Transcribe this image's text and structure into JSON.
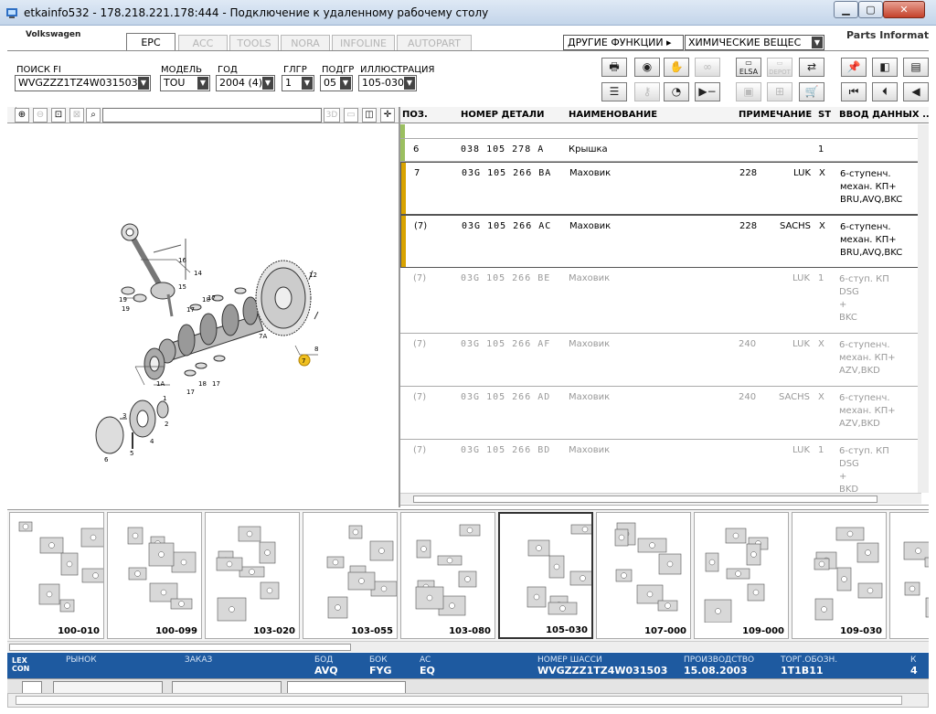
{
  "window": {
    "title": "etkainfo532 - 178.218.221.178:444 - Подключение к удаленному рабочему столу"
  },
  "brand": "Volkswagen",
  "parts_info": "Parts Informati",
  "tabs": [
    "EPC",
    "ACC",
    "TOOLS",
    "NORA",
    "INFOLINE",
    "AUTOPART"
  ],
  "menus": {
    "other_functions": "ДРУГИЕ ФУНКЦИИ ▸",
    "chemicals": "ХИМИЧЕСКИЕ ВЕЩЕС"
  },
  "filters": {
    "search_label": "ПОИСК FI",
    "search_value": "WVGZZZ1TZ4W031503",
    "model_label": "МОДЕЛЬ",
    "model_value": "TOU",
    "year_label": "ГОД",
    "year_value": "2004 (4)",
    "mgroup_label": "ГЛГР",
    "mgroup_value": "1",
    "sgroup_label": "ПОДГР",
    "sgroup_value": "05",
    "illustration_label": "ИЛЛЮСТРАЦИЯ",
    "illustration_value": "105-030"
  },
  "toolbar_buttons": [
    "printer-icon",
    "cd-icon",
    "handshake-icon",
    "glasses-icon",
    "elsa-icon",
    "depot-icon",
    "cart-arrow-icon",
    "pin-icon",
    "prev-page-icon",
    "book-icon",
    "list-icon",
    "key-icon",
    "gauge-icon",
    "play-dash-icon",
    "compare-icon",
    "cart-plus-icon",
    "cart-icon",
    "first-icon",
    "back-icon",
    "rewind-icon"
  ],
  "elsa_label": "ELSA",
  "depot_label": "DEPOT",
  "illustration_tools": {
    "label_3d": "3D"
  },
  "grid": {
    "headers": {
      "pos": "ПОЗ.",
      "part_no": "НОМЕР ДЕТАЛИ",
      "name": "НАИМЕНОВАНИЕ",
      "note": "ПРИМЕЧАНИЕ",
      "st": "ST",
      "data": "ВВОД ДАННЫХ ..."
    },
    "rows": [
      {
        "pos": "6",
        "part_no": "038 105 278 A",
        "name": "Крышка",
        "note_num": "",
        "note": "",
        "st": "1",
        "data": [
          "",
          "",
          ""
        ]
      },
      {
        "pos": "7",
        "part_no": "03G 105 266 BA",
        "name": "Маховик",
        "note_num": "228",
        "note": "LUK",
        "st": "X",
        "data": [
          "6-ступенч.",
          "механ. КП+",
          "BRU,AVQ,BKC"
        ]
      },
      {
        "pos": "(7)",
        "part_no": "03G 105 266 AC",
        "name": "Маховик",
        "note_num": "228",
        "note": "SACHS",
        "st": "X",
        "data": [
          "6-ступенч.",
          "механ. КП+",
          "BRU,AVQ,BKC"
        ]
      },
      {
        "pos": "(7)",
        "part_no": "03G 105 266 BE",
        "name": "Маховик",
        "note_num": "",
        "note": "LUK",
        "st": "1",
        "data": [
          "6-ступ. КП",
          "DSG",
          "+",
          "BKC"
        ]
      },
      {
        "pos": "(7)",
        "part_no": "03G 105 266 AF",
        "name": "Маховик",
        "note_num": "240",
        "note": "LUK",
        "st": "X",
        "data": [
          "6-ступенч.",
          "механ. КП+",
          "AZV,BKD"
        ]
      },
      {
        "pos": "(7)",
        "part_no": "03G 105 266 AD",
        "name": "Маховик",
        "note_num": "240",
        "note": "SACHS",
        "st": "X",
        "data": [
          "6-ступенч.",
          "механ. КП+",
          "AZV,BKD"
        ]
      },
      {
        "pos": "(7)",
        "part_no": "03G 105 266 BD",
        "name": "Маховик",
        "note_num": "",
        "note": "LUK",
        "st": "1",
        "data": [
          "6-ступ. КП",
          "DSG",
          "+",
          "BKD"
        ]
      }
    ]
  },
  "thumbnails": [
    "100-010",
    "100-099",
    "103-020",
    "103-055",
    "103-080",
    "105-030",
    "107-000",
    "109-000",
    "109-030",
    ""
  ],
  "selected_thumbnail": "105-030",
  "status": {
    "logo": "LEX CON",
    "market_label": "РЫНОК",
    "order_label": "ЗАКАЗ",
    "bod_label": "БОД",
    "bod_value": "AVQ",
    "bok_label": "БОК",
    "bok_value": "FYG",
    "ac_label": "AC",
    "ac_value": "EQ",
    "vin_label": "НОМЕР ШАССИ",
    "vin_value": "WVGZZZ1TZ4W031503",
    "prod_label": "ПРОИЗВОДСТВО",
    "prod_value": "15.08.2003",
    "trade_label": "ТОРГ.ОБОЗН.",
    "trade_value": "1T1B11",
    "extra_label": "К",
    "extra_value": "4"
  },
  "diagram_labels": [
    "16",
    "14",
    "15",
    "19",
    "19",
    "18",
    "17",
    "17",
    "12",
    "7A",
    "8",
    "7",
    "1A",
    "17",
    "18",
    "17",
    "3",
    "4",
    "2",
    "5",
    "6",
    "1"
  ]
}
